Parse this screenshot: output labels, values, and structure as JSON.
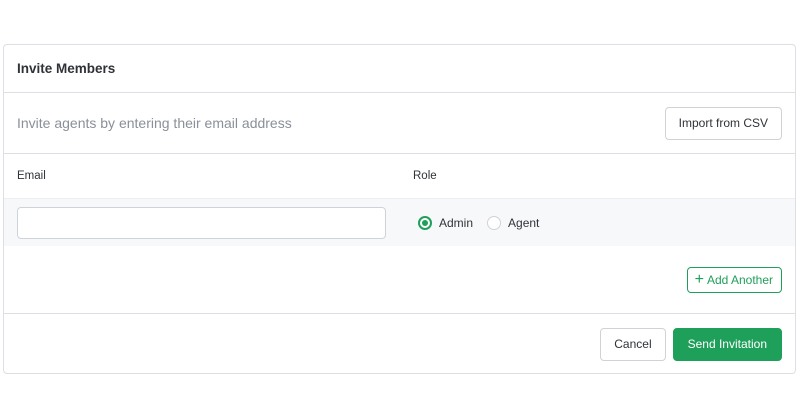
{
  "dialog": {
    "title": "Invite Members"
  },
  "intro": {
    "text": "Invite agents by entering their email address",
    "import_button": "Import from CSV"
  },
  "form": {
    "email_label": "Email",
    "role_label": "Role",
    "email_value": "",
    "email_placeholder": "",
    "roles": [
      {
        "label": "Admin",
        "selected": true
      },
      {
        "label": "Agent",
        "selected": false
      }
    ],
    "add_another_label": "Add Another",
    "add_icon": "plus-icon"
  },
  "footer": {
    "cancel_label": "Cancel",
    "submit_label": "Send Invitation"
  },
  "colors": {
    "accent": "#1fa05a",
    "border": "#dcdfe3",
    "muted_text": "#8a9099"
  }
}
